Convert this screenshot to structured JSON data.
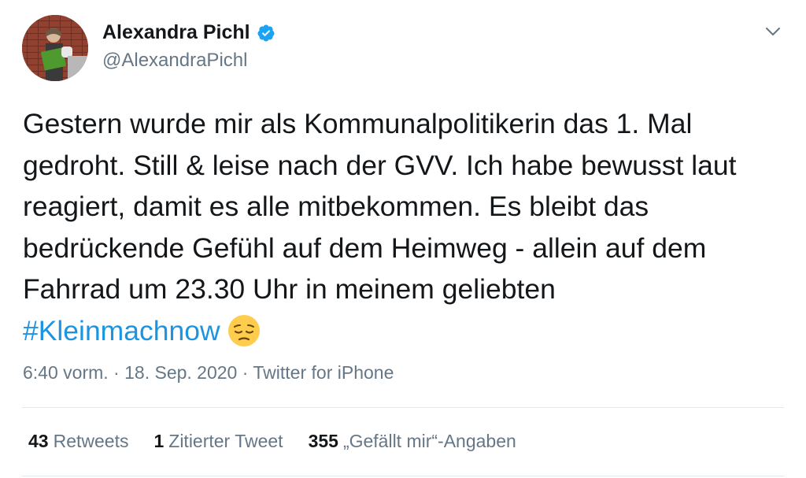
{
  "author": {
    "name": "Alexandra Pichl",
    "handle": "@AlexandraPichl",
    "verified": true
  },
  "tweet": {
    "text": "Gestern wurde mir als Kommunalpolitikerin das 1. Mal gedroht. Still & leise nach der GVV. Ich habe bewusst laut reagiert, damit es alle mitbekommen. Es bleibt das bedrückende Gefühl auf dem Heimweg - allein auf dem Fahrrad um 23.30 Uhr in meinem geliebten",
    "hashtag": "#Kleinmachnow",
    "emoji": "pensive-face"
  },
  "meta": {
    "time": "6:40 vorm.",
    "separator": "·",
    "date": "18. Sep. 2020",
    "source": "Twitter for iPhone"
  },
  "stats": {
    "retweets_count": "43",
    "retweets_label": "Retweets",
    "quotes_count": "1",
    "quotes_label": "Zitierter Tweet",
    "likes_count": "355",
    "likes_label": "„Gefällt mir“-Angaben"
  },
  "colors": {
    "text": "#14171a",
    "secondary": "#657786",
    "link": "#1b95e0",
    "divider": "#e1e8ed",
    "verified": "#1da1f2"
  }
}
